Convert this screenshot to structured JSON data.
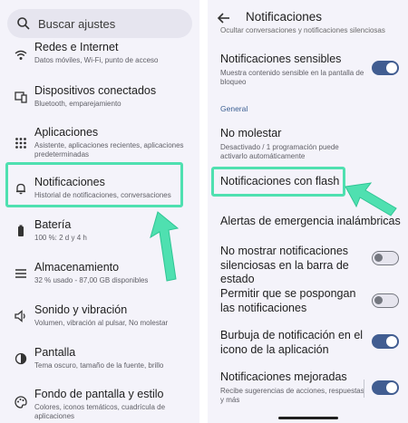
{
  "left": {
    "search_placeholder": "Buscar ajustes",
    "items": [
      {
        "title": "Redes e Internet",
        "sub": "Datos móviles, Wi-Fi, punto de acceso",
        "icon": "wifi-icon"
      },
      {
        "title": "Dispositivos conectados",
        "sub": "Bluetooth, emparejamiento",
        "icon": "devices-icon"
      },
      {
        "title": "Aplicaciones",
        "sub": "Asistente, aplicaciones recientes, aplicaciones predeterminadas",
        "icon": "apps-grid-icon"
      },
      {
        "title": "Notificaciones",
        "sub": "Historial de notificaciones, conversaciones",
        "icon": "bell-icon"
      },
      {
        "title": "Batería",
        "sub": "100 %: 2 d y 4 h",
        "icon": "battery-icon"
      },
      {
        "title": "Almacenamiento",
        "sub": "32 % usado - 87,00 GB disponibles",
        "icon": "storage-icon"
      },
      {
        "title": "Sonido y vibración",
        "sub": "Volumen, vibración al pulsar, No molestar",
        "icon": "volume-icon"
      },
      {
        "title": "Pantalla",
        "sub": "Tema oscuro, tamaño de la fuente, brillo",
        "icon": "brightness-icon"
      },
      {
        "title": "Fondo de pantalla y estilo",
        "sub": "Colores, iconos temáticos, cuadrícula de aplicaciones",
        "icon": "palette-icon"
      }
    ]
  },
  "right": {
    "title": "Notificaciones",
    "cut_line": "Ocultar conversaciones y notificaciones silenciosas",
    "section": "General",
    "items": [
      {
        "title": "Notificaciones sensibles",
        "sub": "Muestra contenido sensible en la pantalla de bloqueo",
        "toggle": "on"
      },
      {
        "title": "No molestar",
        "sub": "Desactivado / 1 programación puede activarlo automáticamente",
        "toggle": null
      },
      {
        "title": "Notificaciones con flash",
        "sub": "",
        "toggle": null
      },
      {
        "title": "Alertas de emergencia inalámbricas",
        "sub": "",
        "toggle": null
      },
      {
        "title": "No mostrar notificaciones silenciosas en la barra de estado",
        "sub": "",
        "toggle": "off"
      },
      {
        "title": "Permitir que se pospongan las notificaciones",
        "sub": "",
        "toggle": "off"
      },
      {
        "title": "Burbuja de notificación en el icono de la aplicación",
        "sub": "",
        "toggle": "on"
      },
      {
        "title": "Notificaciones mejoradas",
        "sub": "Recibe sugerencias de acciones, respuestas y más",
        "toggle": "on"
      }
    ]
  },
  "colors": {
    "highlight": "#4fe0b0",
    "toggle_on": "#415d91",
    "panel_bg": "#f4f3fa"
  }
}
